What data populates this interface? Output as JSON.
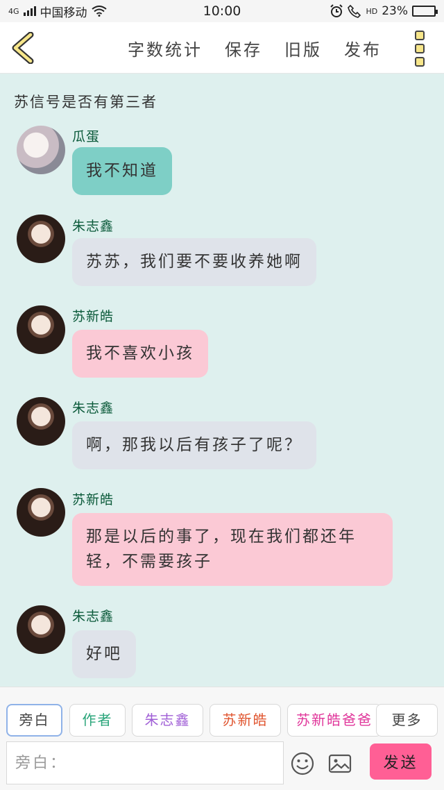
{
  "status_bar": {
    "network": "4G",
    "carrier": "中国移动",
    "time": "10:00",
    "call_icon": "HD",
    "battery": "23%",
    "battery_level": 0.23
  },
  "header": {
    "actions": [
      "字数统计",
      "保存",
      "旧版",
      "发布"
    ]
  },
  "story_title": "苏信号是否有第三者",
  "messages": [
    {
      "sender": "瓜蛋",
      "text": "我不知道",
      "bubble_color": "#7ecfc6",
      "avatar": "avatar-light"
    },
    {
      "sender": "朱志鑫",
      "text": "苏苏，我们要不要收养她啊",
      "bubble_color": "#dfe3ea",
      "avatar": "avatar-dark"
    },
    {
      "sender": "苏新皓",
      "text": "我不喜欢小孩",
      "bubble_color": "#fbc9d5",
      "avatar": "avatar-dark"
    },
    {
      "sender": "朱志鑫",
      "text": "啊，那我以后有孩子了呢？",
      "bubble_color": "#dfe3ea",
      "avatar": "avatar-dark"
    },
    {
      "sender": "苏新皓",
      "text": "那是以后的事了，现在我们都还年轻，不需要孩子",
      "bubble_color": "#fbc9d5",
      "avatar": "avatar-dark"
    },
    {
      "sender": "朱志鑫",
      "text": "好吧",
      "bubble_color": "#dfe3ea",
      "avatar": "avatar-dark"
    }
  ],
  "roles": [
    {
      "label": "旁白",
      "color": "#444444"
    },
    {
      "label": "作者",
      "color": "#2aa57a"
    },
    {
      "label": "朱志鑫",
      "color": "#a05fd6"
    },
    {
      "label": "苏新皓",
      "color": "#e0552f"
    },
    {
      "label": "苏新皓爸爸",
      "color": "#e0359a"
    },
    {
      "label": "更多",
      "color": "#444444"
    }
  ],
  "input": {
    "placeholder": "旁白："
  },
  "send_label": "发送",
  "colors": {
    "accent": "#ff5f95",
    "background": "#def0ee",
    "sender_name": "#0b5a3a"
  }
}
